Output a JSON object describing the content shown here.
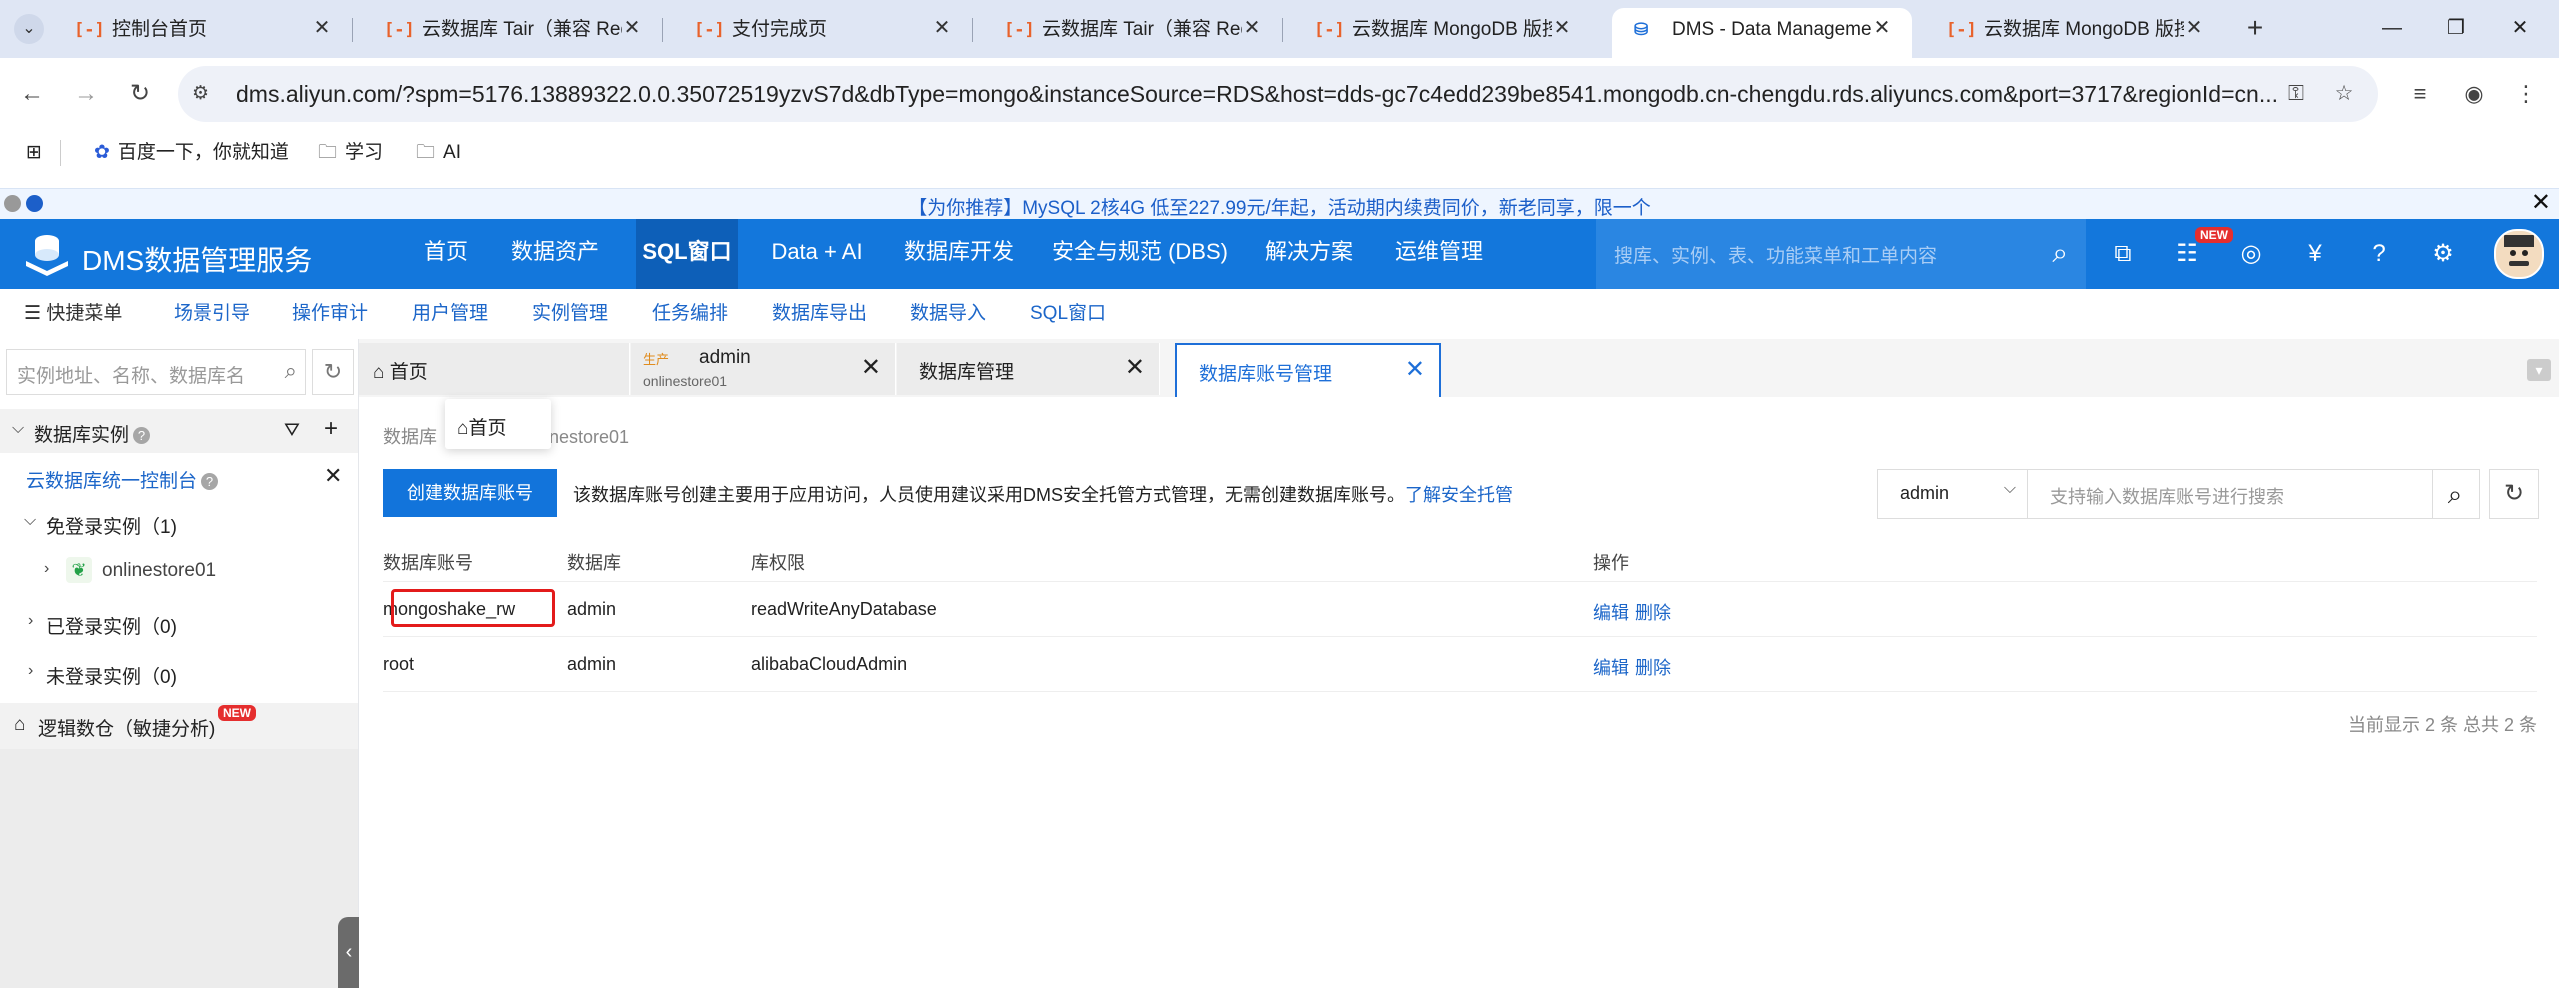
{
  "browser": {
    "tabs": [
      {
        "title": "控制台首页",
        "icon": "aliyun-icon"
      },
      {
        "title": "云数据库 Tair（兼容 Redis",
        "icon": "aliyun-icon"
      },
      {
        "title": "支付完成页",
        "icon": "aliyun-icon"
      },
      {
        "title": "云数据库 Tair（兼容 Redis",
        "icon": "aliyun-icon"
      },
      {
        "title": "云数据库 MongoDB 版控",
        "icon": "aliyun-icon"
      },
      {
        "title": "DMS - Data Management",
        "icon": "dms-icon"
      },
      {
        "title": "云数据库 MongoDB 版控",
        "icon": "aliyun-icon"
      }
    ],
    "active_tab_index": 5,
    "url": "dms.aliyun.com/?spm=5176.13889322.0.0.35072519yzvS7d&dbType=mongo&instanceSource=RDS&host=dds-gc7c4edd239be8541.mongodb.cn-chengdu.rds.aliyuncs.com&port=3717&regionId=cn...",
    "bookmarks": [
      {
        "label": "百度一下，你就知道",
        "icon": "baidu-paw-icon"
      },
      {
        "label": "学习",
        "icon": "folder-icon"
      },
      {
        "label": "AI",
        "icon": "folder-icon"
      }
    ]
  },
  "promo": {
    "text": "【为你推荐】MySQL 2核4G 低至227.99元/年起，活动期内续费同价，新老同享，限一个"
  },
  "topnav": {
    "brand": "DMS数据管理服务",
    "items": [
      "首页",
      "数据资产",
      "SQL窗口",
      "Data + AI",
      "数据库开发",
      "安全与规范 (DBS)",
      "解决方案",
      "运维管理"
    ],
    "active_index": 2,
    "search_placeholder": "搜库、实例、表、功能菜单和工单内容",
    "new_badge": "NEW"
  },
  "quickmenu": {
    "first": "快捷菜单",
    "items": [
      "场景引导",
      "操作审计",
      "用户管理",
      "实例管理",
      "任务编排",
      "数据库导出",
      "数据导入",
      "SQL窗口"
    ]
  },
  "sidebar": {
    "search_placeholder": "实例地址、名称、数据库名",
    "section_title": "数据库实例",
    "console_link": "云数据库统一控制台",
    "groups": [
      {
        "label": "免登录实例（1)"
      },
      {
        "label": "已登录实例（0)"
      },
      {
        "label": "未登录实例（0)"
      }
    ],
    "instance": "onlinestore01",
    "logical_dw": "逻辑数仓（敏捷分析)",
    "logical_badge": "NEW"
  },
  "content_tabs": [
    {
      "title": "首页"
    },
    {
      "title": "admin",
      "tag": "生产",
      "sub": "onlinestore01"
    },
    {
      "title": "数据库管理"
    },
    {
      "title": "数据库账号管理"
    }
  ],
  "breadcrumb": "数据库账号管理 / onlinestore01",
  "breadcrumb_visible_start": "数据库",
  "breadcrumb_visible_end": "nestore01",
  "tooltip": "首页",
  "main": {
    "create_button": "创建数据库账号",
    "notice": "该数据库账号创建主要用于应用访问，人员使用建议采用DMS安全托管方式管理，无需创建数据库账号。",
    "notice_link": "了解安全托管",
    "filter_select": "admin",
    "filter_placeholder": "支持输入数据库账号进行搜索",
    "columns": [
      "数据库账号",
      "数据库",
      "库权限",
      "操作"
    ],
    "rows": [
      {
        "account": "mongoshake_rw",
        "db": "admin",
        "perm": "readWriteAnyDatabase",
        "edit": "编辑",
        "delete": "删除"
      },
      {
        "account": "root",
        "db": "admin",
        "perm": "alibabaCloudAdmin",
        "edit": "编辑",
        "delete": "删除"
      }
    ],
    "pager": "当前显示 2 条 总共 2 条"
  }
}
